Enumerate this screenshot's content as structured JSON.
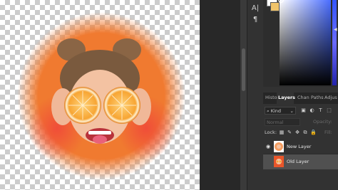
{
  "tool_strip": {
    "icons": [
      "type-icon",
      "paragraph-icon"
    ],
    "type_glyph": "A|",
    "paragraph_glyph": "¶"
  },
  "layers_panel": {
    "tabs": [
      {
        "label": "Histo",
        "active": false
      },
      {
        "label": "Layers",
        "active": true
      },
      {
        "label": "Chan",
        "active": false
      },
      {
        "label": "Paths",
        "active": false
      },
      {
        "label": "Adjus",
        "active": false
      }
    ],
    "filter_kind": "Kind",
    "blend_mode": "Normal",
    "opacity_label": "Opacity:",
    "lock_label": "Lock:",
    "fill_label": "Fill:",
    "layers": [
      {
        "name": "New Layer",
        "visible": true,
        "selected": false
      },
      {
        "name": "Old Layer",
        "visible": false,
        "selected": true
      }
    ]
  },
  "colors": {
    "foreground": "#ffffff",
    "background": "#f0c46a",
    "photo_backdrop": "#f07a30",
    "canvas_check": "#cccccc"
  }
}
